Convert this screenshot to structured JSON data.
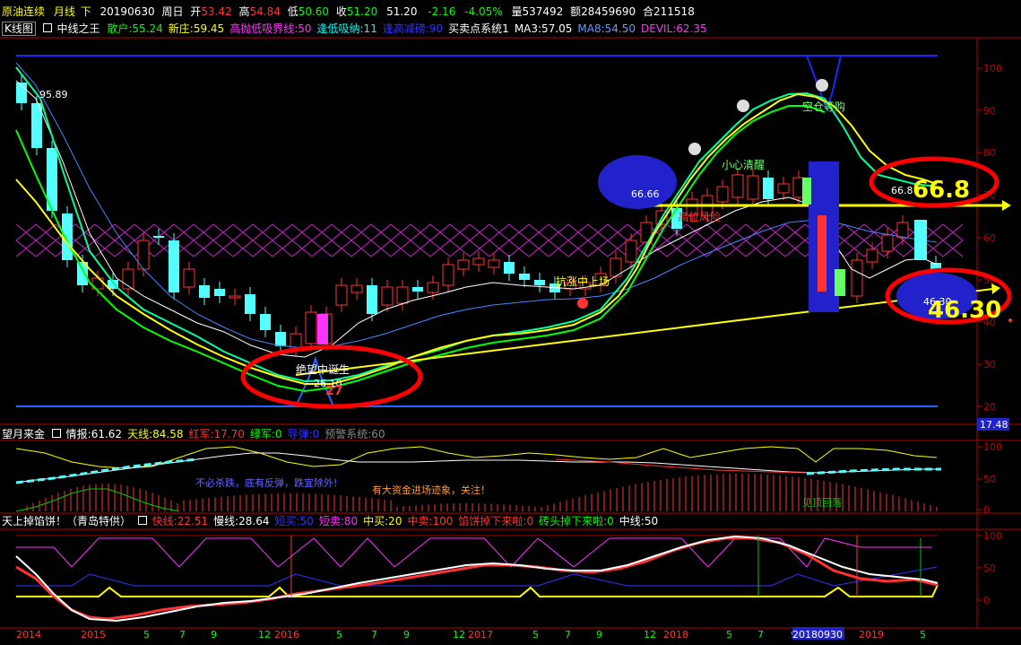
{
  "header": {
    "symbol": "原油连续",
    "period": "月线",
    "arrow": "下",
    "date": "20190630",
    "weekday": "周日",
    "open_label": "开",
    "open": "53.42",
    "high_label": "高",
    "high": "54.84",
    "low_label": "低",
    "low": "50.60",
    "close_label": "收",
    "close": "51.20",
    "last": "51.20",
    "change": "-2.16",
    "change_pct": "-4.05%",
    "volume": "量537492",
    "amount": "额28459690",
    "position": "合211518"
  },
  "indicator_bar": {
    "kline": "K线图",
    "main_name": "中线之王",
    "items": [
      {
        "text": "散户:55.24",
        "color": "#00ff00"
      },
      {
        "text": "新庄:59.45",
        "color": "#ffff00"
      },
      {
        "text": "高抛低吸界线:50",
        "color": "#ff33ff"
      },
      {
        "text": "逢低吸纳:11",
        "color": "#00ffff"
      },
      {
        "text": "逢高减磅:90",
        "color": "#3333ff"
      },
      {
        "text": "买卖点系统1",
        "color": "#ffffff"
      },
      {
        "text": "MA3:57.05",
        "color": "#ffffff"
      },
      {
        "text": "MA8:54.50",
        "color": "#6699ff"
      },
      {
        "text": "DEVIL:62.35",
        "color": "#ff33ff"
      }
    ]
  },
  "main_chart": {
    "y_ticks": [
      "100",
      "90",
      "80",
      "70",
      "60",
      "50",
      "40",
      "30",
      "20"
    ],
    "last_price_tag": "17.48",
    "labels": {
      "peak": "95.89",
      "left_circle": "66.66",
      "right_top": "66.8",
      "big_top": "66.8",
      "big_bottom": "46.30",
      "small_bottom": "46.30",
      "bottom_low": "26.10",
      "bottom_red": "27",
      "text_careful": "小心清醒",
      "text_empty": "空仓等购",
      "text_risk": "高位风险",
      "text_enter": "抗涨中上场",
      "text_despair": "绝望中诞生"
    }
  },
  "panel2": {
    "title": "望月来金",
    "items": [
      {
        "text": "情报:61.62",
        "color": "#ffffff"
      },
      {
        "text": "天线:84.58",
        "color": "#ffff00"
      },
      {
        "text": "红军:17.70",
        "color": "#ff3333"
      },
      {
        "text": "绿军:0",
        "color": "#00ff00"
      },
      {
        "text": "导弹:0",
        "color": "#3333ff"
      },
      {
        "text": "预警系统:60",
        "color": "#888888"
      }
    ],
    "y_ticks": [
      "100",
      "50",
      "0"
    ],
    "annotations": {
      "no_kill": "不必杀跌，底有反弹，跌宜除外!",
      "funds": "有大资金进场迹象，关注！",
      "top_back": "见顶回落"
    }
  },
  "panel3": {
    "title": "天上掉馅饼！（青岛特供）",
    "items": [
      {
        "text": "快线:22.51",
        "color": "#ff3333"
      },
      {
        "text": "慢线:28.64",
        "color": "#ffffff"
      },
      {
        "text": "短买:50",
        "color": "#3333ff"
      },
      {
        "text": "短卖:80",
        "color": "#ff33ff"
      },
      {
        "text": "中买:20",
        "color": "#ffff00"
      },
      {
        "text": "中卖:100",
        "color": "#ff3333"
      },
      {
        "text": "馅饼掉下来啦:0",
        "color": "#ff3333"
      },
      {
        "text": "砖头掉下来啦:0",
        "color": "#00ff00"
      },
      {
        "text": "中线:50",
        "color": "#ffffff"
      }
    ],
    "y_ticks": [
      "100",
      "50",
      "0"
    ]
  },
  "x_axis": {
    "labels": [
      "2014",
      "2015",
      "5",
      "7",
      "9",
      "12",
      "2016",
      "5",
      "7",
      "9",
      "12",
      "2017",
      "5",
      "7",
      "9",
      "12",
      "2018",
      "5",
      "7",
      "9",
      "20180930",
      "2019",
      "5"
    ]
  },
  "colors": {
    "up": "#ff3333",
    "down": "#54ffff",
    "frame": "#b80000",
    "bg": "#000000",
    "circle": "#ff0000"
  }
}
